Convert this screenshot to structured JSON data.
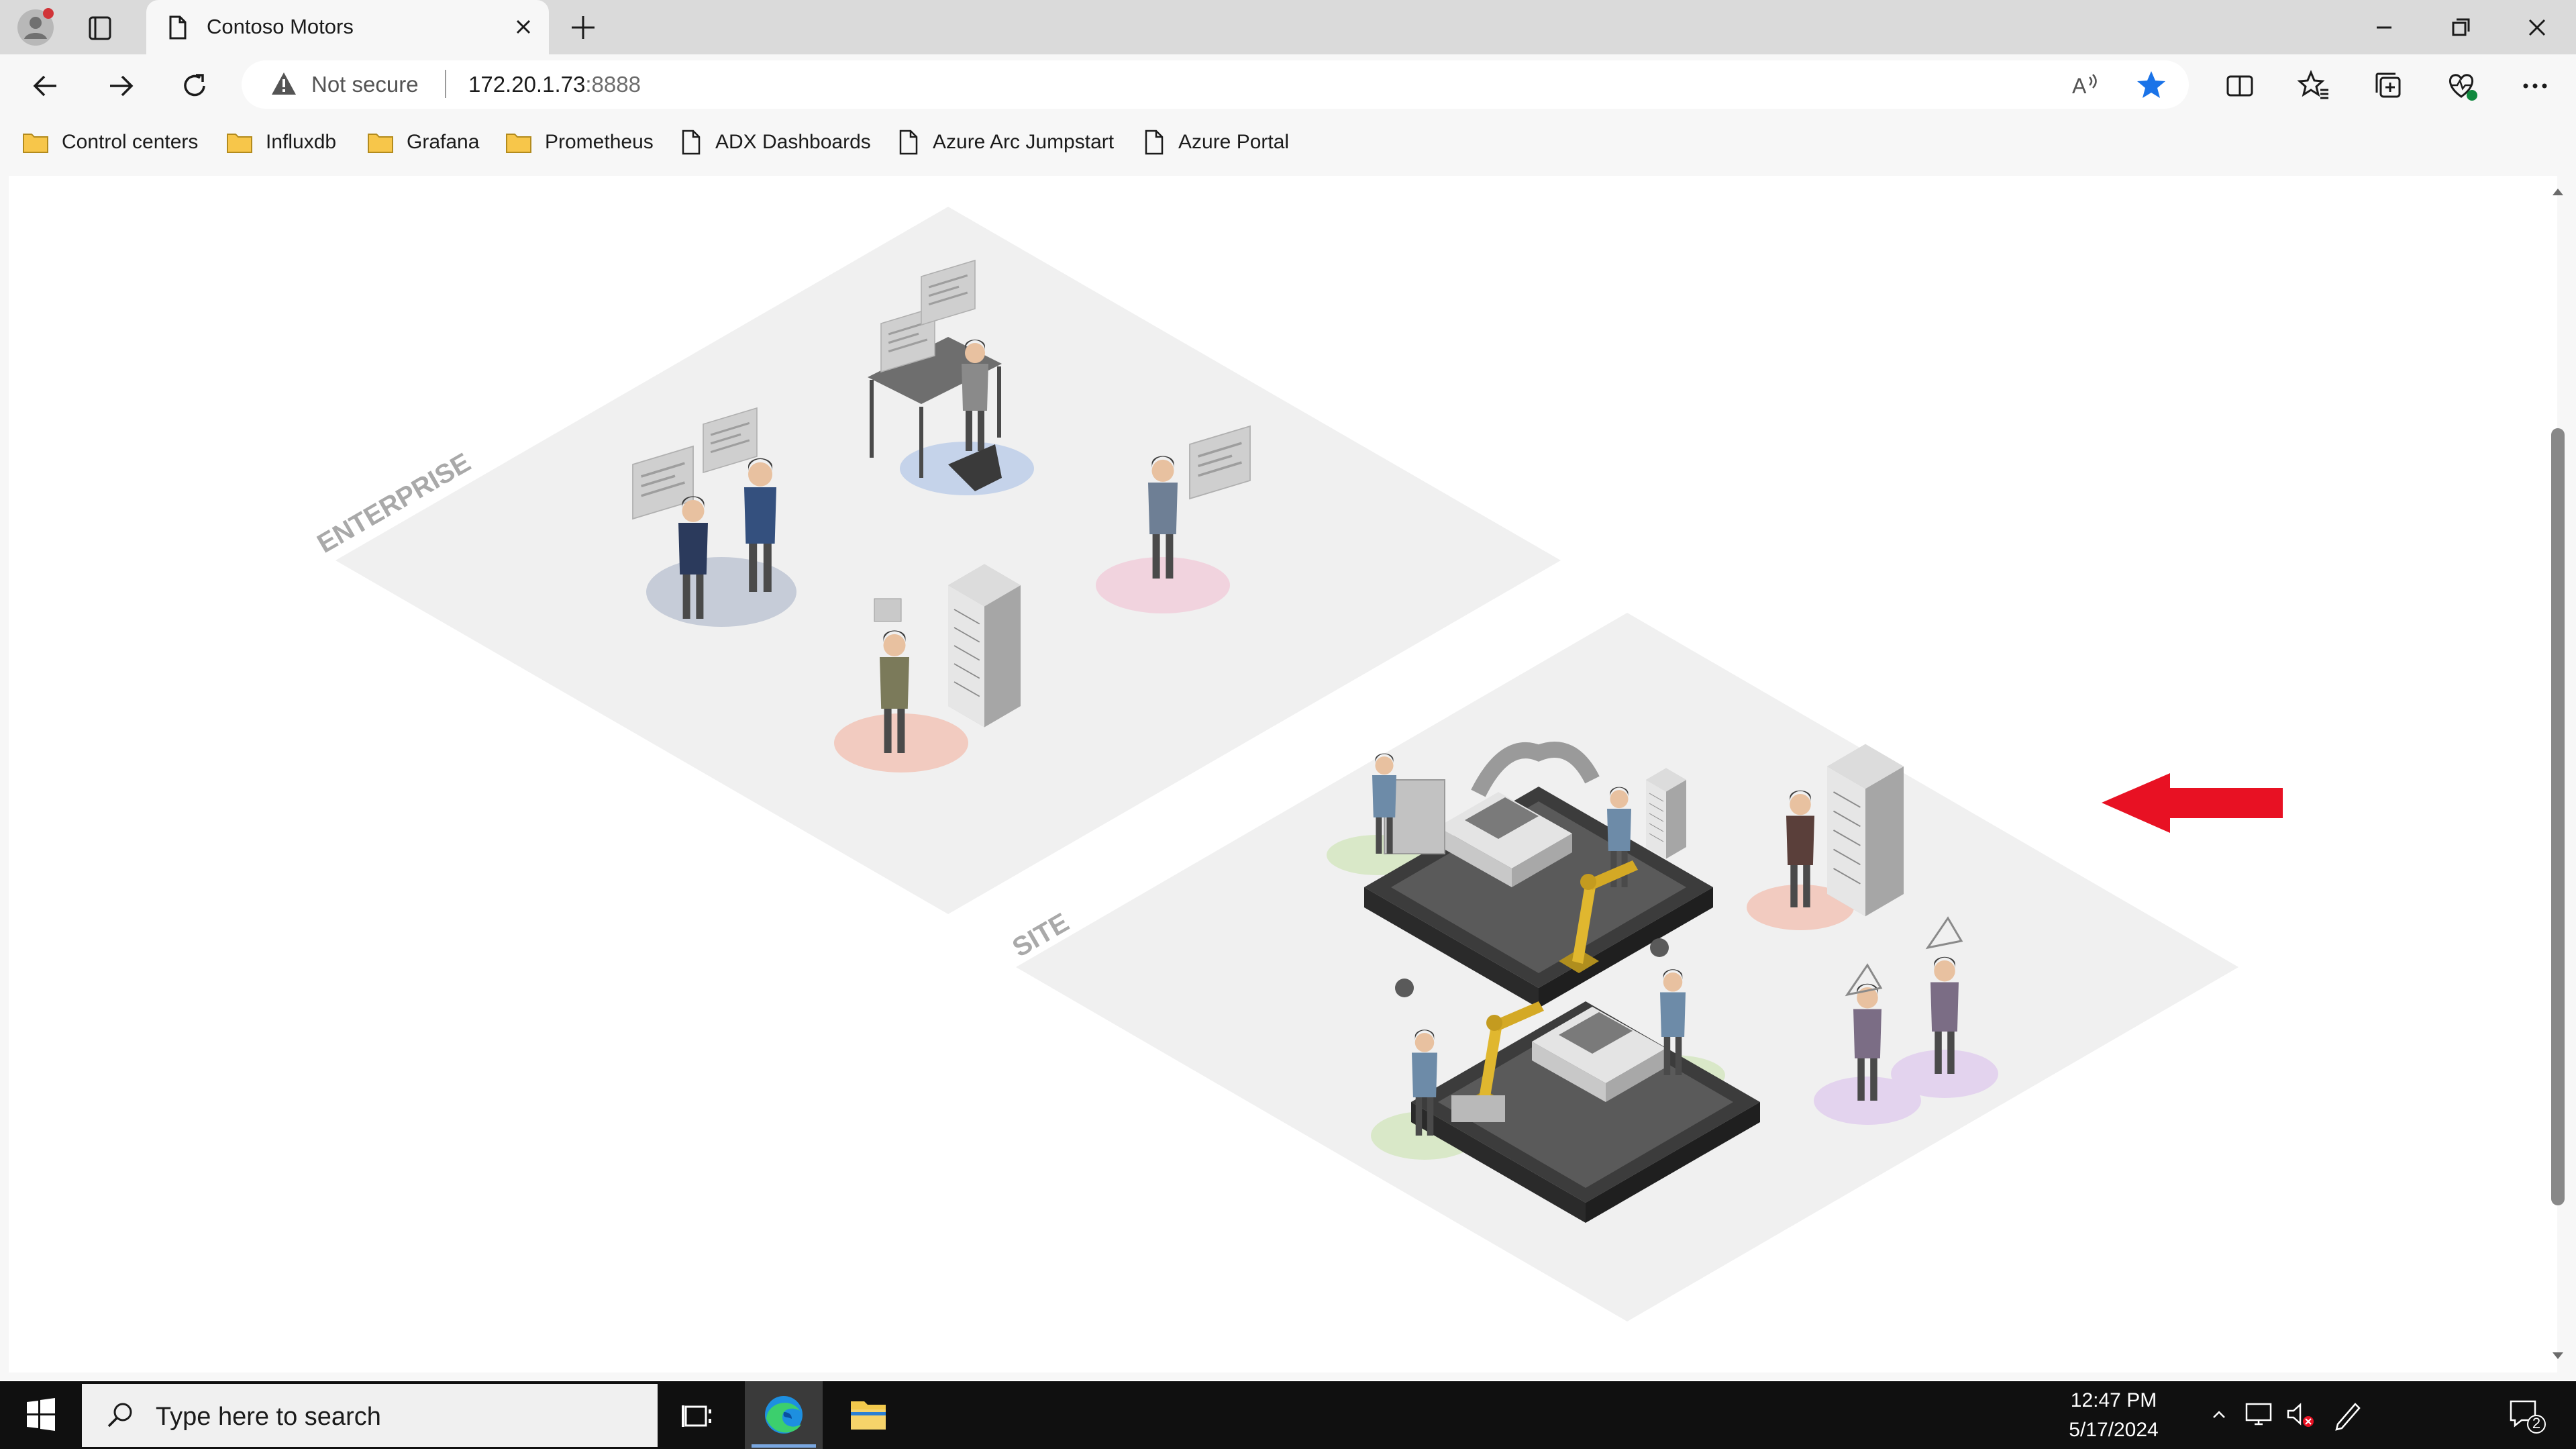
{
  "browser": {
    "tab": {
      "title": "Contoso Motors",
      "icon": "page-icon"
    },
    "address": {
      "security_label": "Not secure",
      "host": "172.20.1.73",
      "port": ":8888"
    },
    "bookmarks": [
      {
        "label": "Control centers",
        "icon": "folder-icon"
      },
      {
        "label": "Influxdb",
        "icon": "folder-icon"
      },
      {
        "label": "Grafana",
        "icon": "folder-icon"
      },
      {
        "label": "Prometheus",
        "icon": "folder-icon"
      },
      {
        "label": "ADX Dashboards",
        "icon": "page-icon"
      },
      {
        "label": "Azure Arc Jumpstart",
        "icon": "page-icon"
      },
      {
        "label": "Azure Portal",
        "icon": "page-icon"
      }
    ]
  },
  "page": {
    "scene": {
      "zones": [
        {
          "label": "ENTERPRISE"
        },
        {
          "label": "SITE"
        }
      ],
      "annotation": "red-arrow-pointing-left"
    }
  },
  "taskbar": {
    "search_placeholder": "Type here to search",
    "clock": {
      "time": "12:47 PM",
      "date": "5/17/2024"
    },
    "notification_count": "2"
  },
  "colors": {
    "tabstrip": "#dadada",
    "toolbar": "#f7f7f7",
    "accent_star": "#1a73e8",
    "arrow": "#e81123",
    "taskbar": "#101010"
  }
}
